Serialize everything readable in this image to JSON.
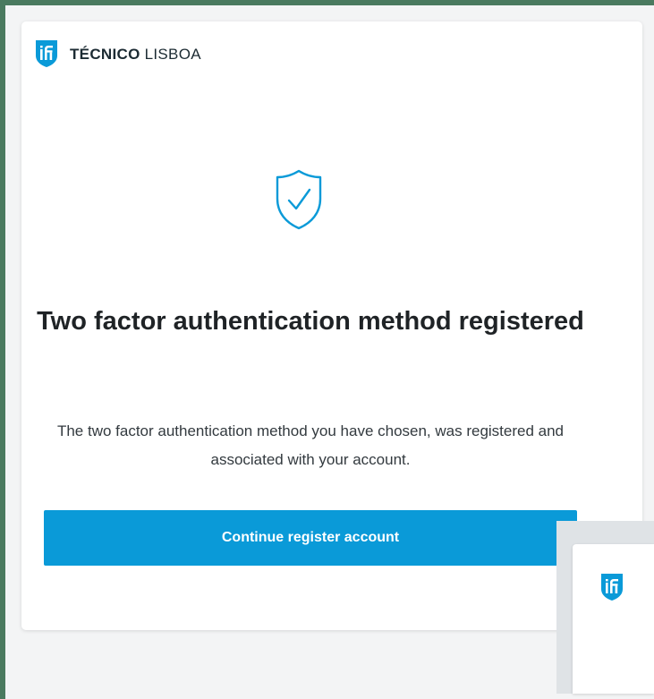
{
  "brand": {
    "name_bold": "TÉCNICO",
    "name_light": " LISBOA",
    "accent_color": "#0a9ad8"
  },
  "status_icon": "shield-check-icon",
  "title": "Two factor authentication method registered",
  "message": "The two factor authentication method you have chosen, was registered and associated with your account.",
  "continue_button": {
    "label": "Continue register account"
  }
}
